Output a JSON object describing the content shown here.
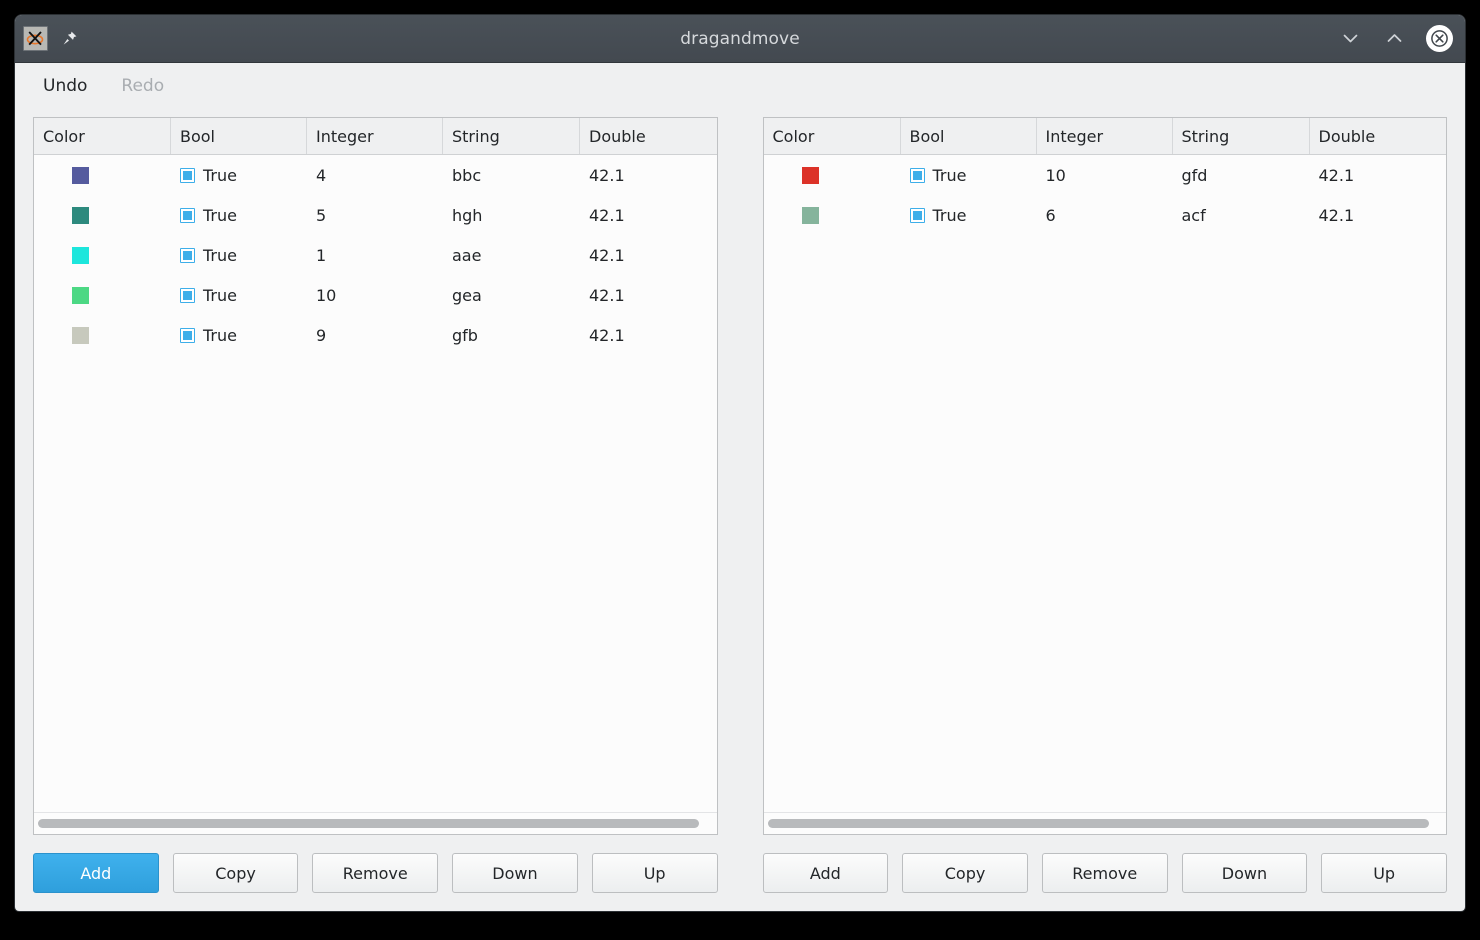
{
  "window": {
    "title": "dragandmove",
    "app_icon": "x11-logo-icon",
    "pin_icon": "pin-icon",
    "controls": {
      "minimize": "chevron-down-icon",
      "maximize": "chevron-up-icon",
      "close": "close-circle-icon"
    }
  },
  "menubar": {
    "items": [
      {
        "label": "Undo",
        "enabled": true
      },
      {
        "label": "Redo",
        "enabled": false
      }
    ]
  },
  "colors": {
    "accent": "#3daee9",
    "titlebar": "#4a5158",
    "window_bg": "#eff0f1",
    "table_bg": "#fcfcfc",
    "header_bg": "#eff0f1"
  },
  "panes": [
    {
      "id": "left",
      "columns": [
        "Color",
        "Bool",
        "Integer",
        "String",
        "Double"
      ],
      "rows": [
        {
          "color": "#555b9e",
          "bool": "True",
          "integer": "4",
          "string": "bbc",
          "double": "42.1"
        },
        {
          "color": "#2d8a7e",
          "bool": "True",
          "integer": "5",
          "string": "hgh",
          "double": "42.1"
        },
        {
          "color": "#1de6dc",
          "bool": "True",
          "integer": "1",
          "string": "aae",
          "double": "42.1"
        },
        {
          "color": "#4cd884",
          "bool": "True",
          "integer": "10",
          "string": "gea",
          "double": "42.1"
        },
        {
          "color": "#c7c9bd",
          "bool": "True",
          "integer": "9",
          "string": "gfb",
          "double": "42.1"
        }
      ],
      "buttons": [
        {
          "label": "Add",
          "primary": true
        },
        {
          "label": "Copy",
          "primary": false
        },
        {
          "label": "Remove",
          "primary": false
        },
        {
          "label": "Down",
          "primary": false
        },
        {
          "label": "Up",
          "primary": false
        }
      ]
    },
    {
      "id": "right",
      "columns": [
        "Color",
        "Bool",
        "Integer",
        "String",
        "Double"
      ],
      "rows": [
        {
          "color": "#dc3228",
          "bool": "True",
          "integer": "10",
          "string": "gfd",
          "double": "42.1"
        },
        {
          "color": "#85b49c",
          "bool": "True",
          "integer": "6",
          "string": "acf",
          "double": "42.1"
        }
      ],
      "buttons": [
        {
          "label": "Add",
          "primary": false
        },
        {
          "label": "Copy",
          "primary": false
        },
        {
          "label": "Remove",
          "primary": false
        },
        {
          "label": "Down",
          "primary": false
        },
        {
          "label": "Up",
          "primary": false
        }
      ]
    }
  ]
}
